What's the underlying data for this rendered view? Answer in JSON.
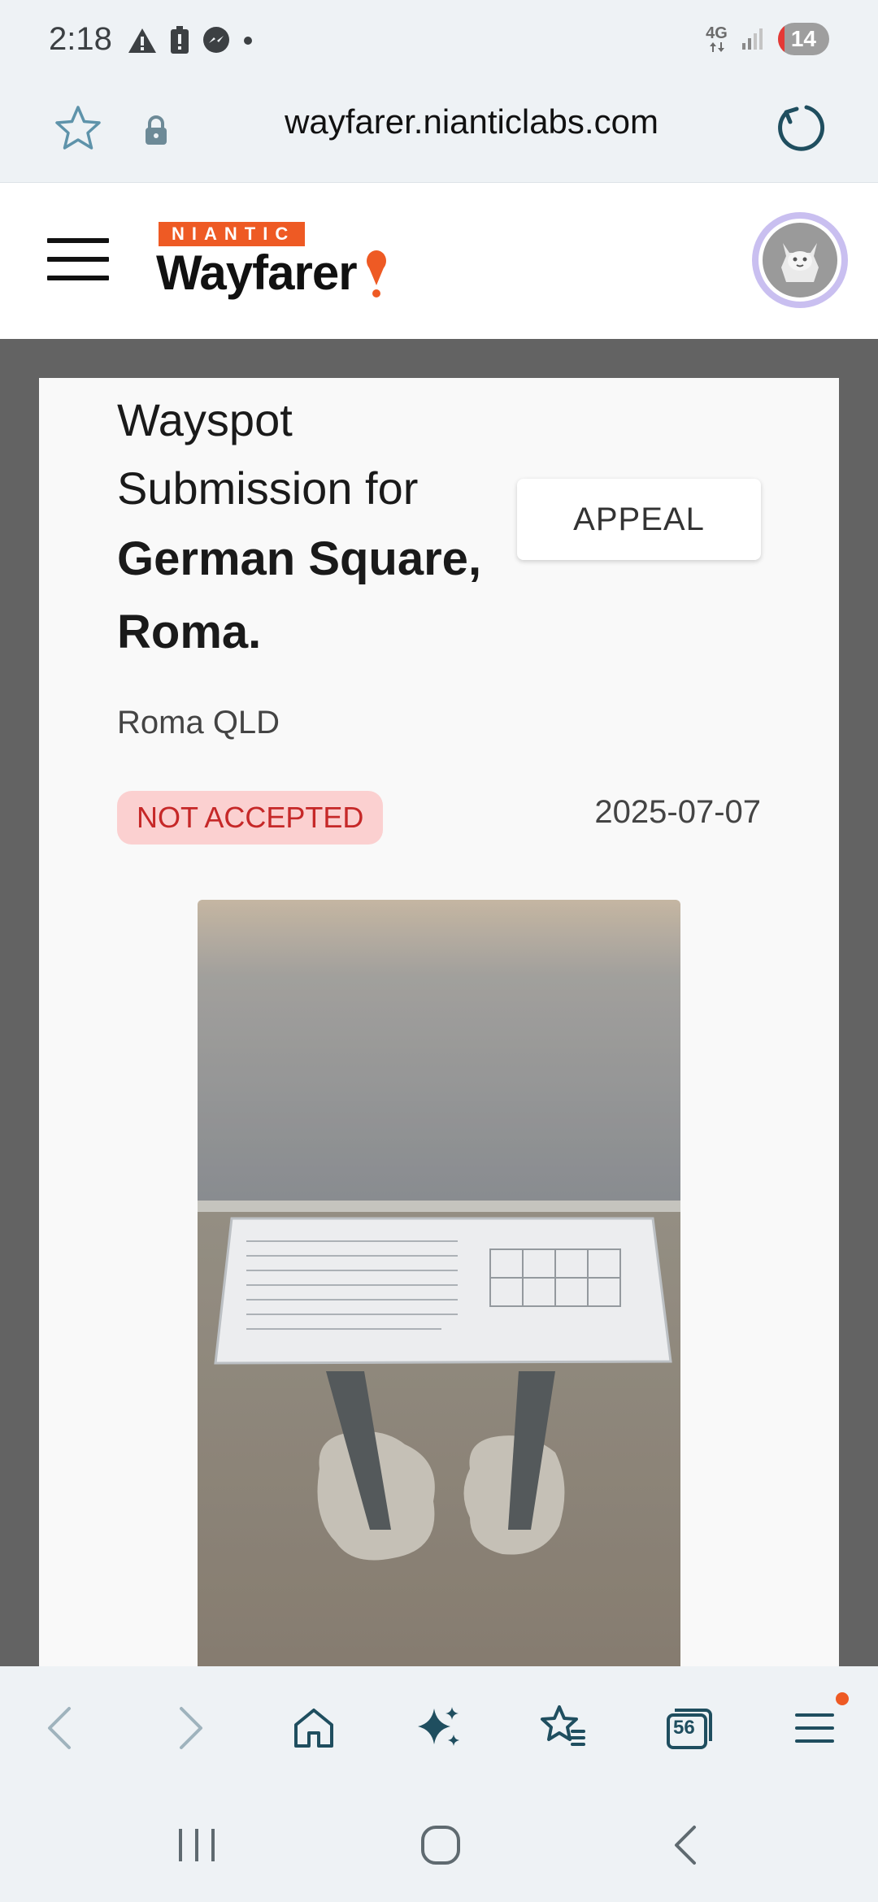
{
  "status_bar": {
    "time": "2:18",
    "network": "4G",
    "battery": "14",
    "icons": [
      "warning-icon",
      "battery-alert-icon",
      "messenger-icon",
      "dot-icon",
      "signal-icon"
    ]
  },
  "browser": {
    "url": "wayfarer.nianticlabs.com"
  },
  "header": {
    "brand_tag": "NIANTIC",
    "brand_name": "Wayfarer",
    "accent": "#ee5a24"
  },
  "submission": {
    "title_prefix": "Wayspot Submission for",
    "title_name": "German Square, Roma.",
    "appeal_label": "APPEAL",
    "location": "Roma QLD",
    "status": "NOT ACCEPTED",
    "status_color": "#c62828",
    "date": "2025-07-07"
  },
  "bottom_nav": {
    "tabs_count": "56",
    "items": [
      "back-icon",
      "forward-icon",
      "home-icon",
      "sparkle-icon",
      "bookmarks-icon",
      "tabs-icon",
      "menu-icon"
    ]
  },
  "system_nav": {
    "items": [
      "recents-icon",
      "home-circle-icon",
      "system-back-icon"
    ]
  }
}
